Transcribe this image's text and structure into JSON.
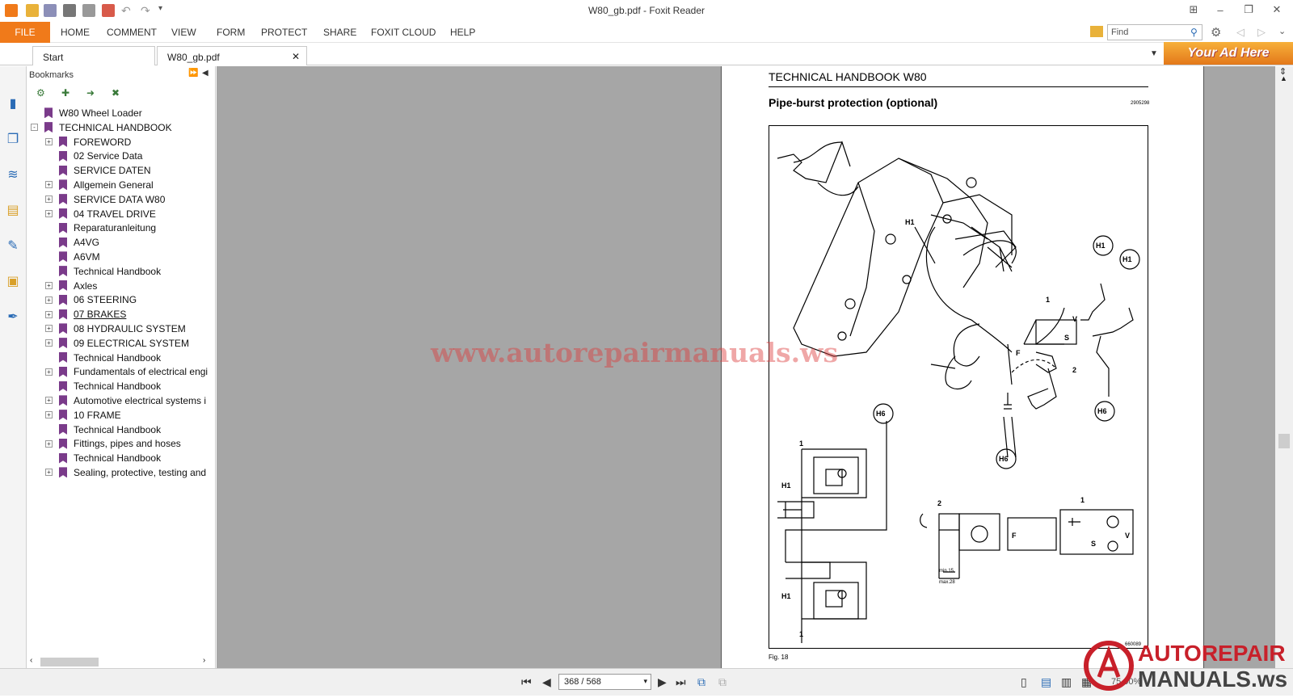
{
  "window": {
    "title": "W80_gb.pdf - Foxit Reader"
  },
  "menu": {
    "file": "FILE",
    "items": [
      "HOME",
      "COMMENT",
      "VIEW",
      "FORM",
      "PROTECT",
      "SHARE",
      "FOXIT CLOUD",
      "HELP"
    ]
  },
  "search": {
    "placeholder": "Find"
  },
  "tabs": [
    "Start",
    "W80_gb.pdf"
  ],
  "ad": {
    "text": "Your Ad Here"
  },
  "bookmarks": {
    "header": "Bookmarks",
    "items": [
      {
        "label": "W80 Wheel Loader",
        "level": 0,
        "expand": ""
      },
      {
        "label": "TECHNICAL HANDBOOK",
        "level": 0,
        "expand": "-"
      },
      {
        "label": "FOREWORD",
        "level": 1,
        "expand": "+"
      },
      {
        "label": "02 Service Data",
        "level": 1,
        "expand": ""
      },
      {
        "label": "SERVICE DATEN",
        "level": 1,
        "expand": ""
      },
      {
        "label": "Allgemein General",
        "level": 1,
        "expand": "+"
      },
      {
        "label": "SERVICE DATA W80",
        "level": 1,
        "expand": "+"
      },
      {
        "label": "04 TRAVEL DRIVE",
        "level": 1,
        "expand": "+"
      },
      {
        "label": "Reparaturanleitung",
        "level": 1,
        "expand": ""
      },
      {
        "label": "A4VG",
        "level": 1,
        "expand": ""
      },
      {
        "label": "A6VM",
        "level": 1,
        "expand": ""
      },
      {
        "label": "Technical Handbook",
        "level": 1,
        "expand": ""
      },
      {
        "label": "Axles",
        "level": 1,
        "expand": "+"
      },
      {
        "label": "06 STEERING",
        "level": 1,
        "expand": "+"
      },
      {
        "label": "07 BRAKES",
        "level": 1,
        "expand": "+",
        "underline": true
      },
      {
        "label": "08 HYDRAULIC SYSTEM",
        "level": 1,
        "expand": "+"
      },
      {
        "label": "09 ELECTRICAL SYSTEM",
        "level": 1,
        "expand": "+"
      },
      {
        "label": "Technical Handbook",
        "level": 1,
        "expand": ""
      },
      {
        "label": "Fundamentals of electrical engi",
        "level": 1,
        "expand": "+"
      },
      {
        "label": "Technical Handbook",
        "level": 1,
        "expand": ""
      },
      {
        "label": "Automotive electrical systems i",
        "level": 1,
        "expand": "+"
      },
      {
        "label": "10 FRAME",
        "level": 1,
        "expand": "+"
      },
      {
        "label": "Technical Handbook",
        "level": 1,
        "expand": ""
      },
      {
        "label": "Fittings, pipes and hoses",
        "level": 1,
        "expand": "+"
      },
      {
        "label": "Technical Handbook",
        "level": 1,
        "expand": ""
      },
      {
        "label": "Sealing, protective, testing and",
        "level": 1,
        "expand": "+"
      }
    ]
  },
  "page": {
    "header": "TECHNICAL HANDBOOK W80",
    "title": "Pipe-burst protection (optional)",
    "code": "2905298",
    "figure_caption": "Fig. 18",
    "figure_code": "660089",
    "labels": {
      "h1": "H1",
      "h6": "H6",
      "one": "1",
      "two": "2",
      "v": "V",
      "s": "S",
      "f": "F",
      "min": "min.15",
      "max": "max.28"
    },
    "watermark": "www.autorepairmanuals.ws"
  },
  "status": {
    "page_field": "368 / 568",
    "zoom": "75.00%"
  },
  "logo": {
    "line1": "AUTOREPAIR",
    "line2": "MANUALS.ws"
  },
  "colors": {
    "accent": "#f07a1a",
    "bookmark_flag": "#7a3b8a",
    "viewer_bg": "#a6a6a6"
  }
}
